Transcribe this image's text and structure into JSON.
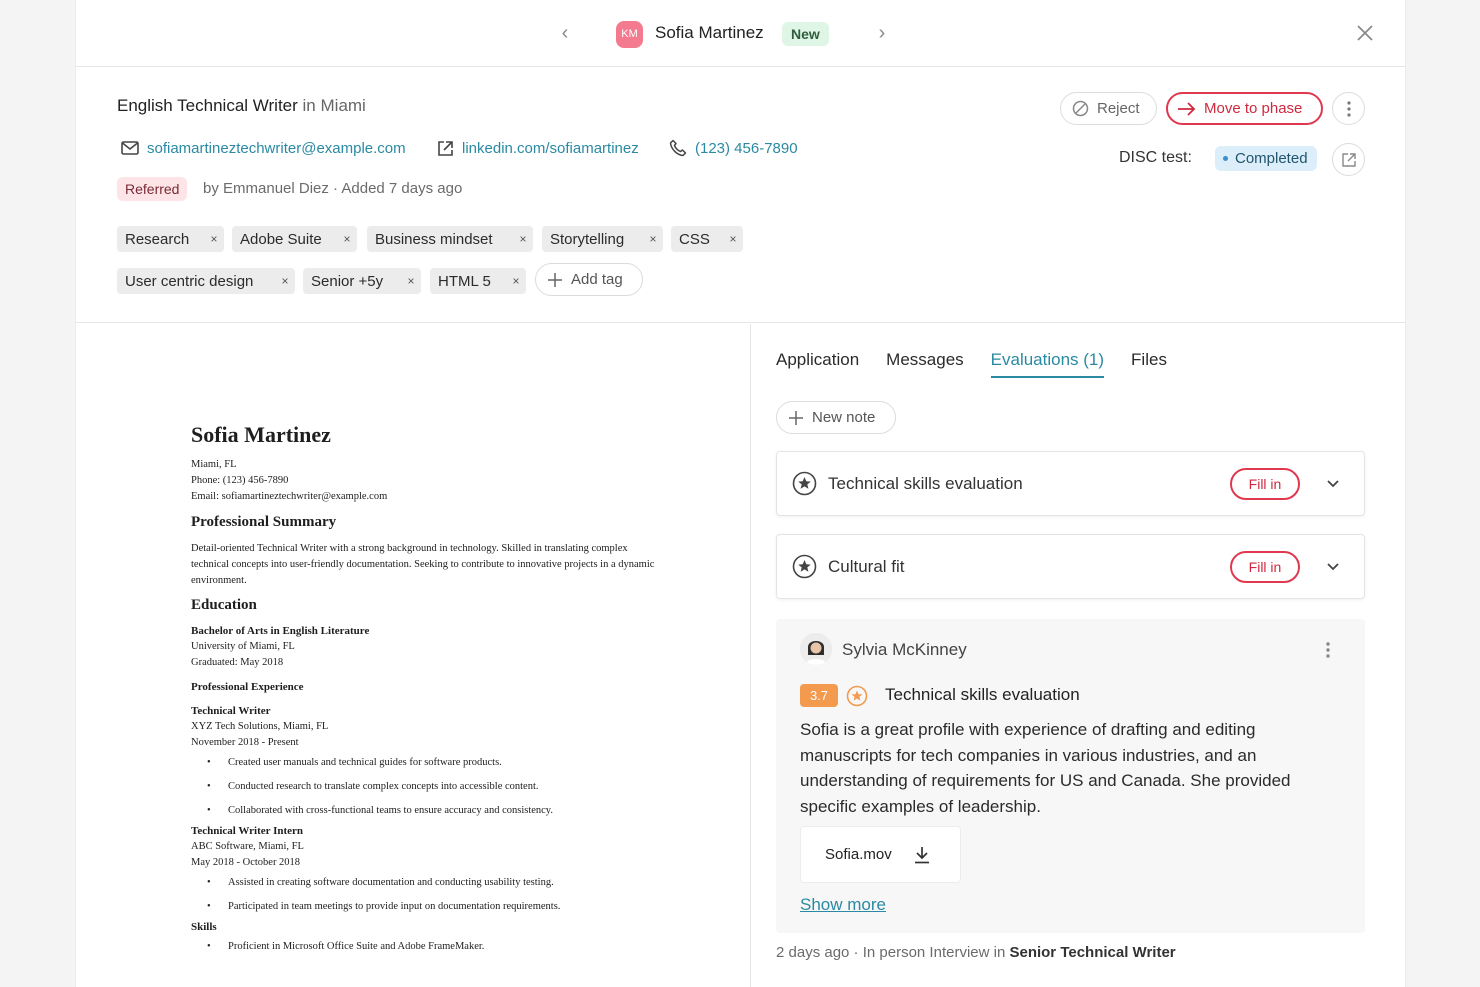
{
  "nav": {
    "avatar_initials": "KM",
    "candidate_name": "Sofia Martinez",
    "status_badge": "New"
  },
  "header": {
    "job_title": "English Technical Writer",
    "job_in": "in",
    "job_location": "Miami",
    "email": "sofiamartineztechwriter@example.com",
    "linkedin": "linkedin.com/sofiamartinez",
    "phone": "(123) 456-7890",
    "referral_badge": "Referred",
    "referral_meta": "by Emmanuel Diez · Added 7 days ago",
    "tags": [
      "Research",
      "Adobe Suite",
      "Business mindset",
      "Storytelling",
      "CSS",
      "User centric design",
      "Senior +5y",
      "HTML 5"
    ],
    "tag_remove_glyph": "×",
    "add_tag_label": "Add tag",
    "reject_label": "Reject",
    "move_label": "Move to phase",
    "disc_label": "DISC test:",
    "disc_status": "Completed",
    "colors": {
      "accent": "#2a8aa3",
      "primary": "#e0384f"
    }
  },
  "resume": {
    "name": "Sofia Martinez",
    "contact_lines": [
      "Miami, FL",
      "Phone: (123) 456-7890",
      "Email: sofiamartineztechwriter@example.com"
    ],
    "summary_heading": "Professional Summary",
    "summary": "Detail-oriented Technical Writer with a strong background in technology. Skilled in translating complex technical concepts into user-friendly documentation. Seeking to contribute to innovative projects in a dynamic environment.",
    "education_heading": "Education",
    "degree": "Bachelor of Arts in English Literature",
    "university": "University of Miami, FL",
    "graduated": "Graduated: May 2018",
    "experience_heading": "Professional Experience",
    "job1_title": "Technical Writer",
    "job1_company": "XYZ Tech Solutions, Miami, FL",
    "job1_dates": "November 2018 - Present",
    "job1_bullets": [
      "Created user manuals and technical guides for software products.",
      "Conducted research to translate complex concepts into accessible content.",
      "Collaborated with cross-functional teams to ensure accuracy and consistency."
    ],
    "job2_title": "Technical Writer Intern",
    "job2_company": "ABC Software, Miami, FL",
    "job2_dates": "May 2018 - October 2018",
    "job2_bullets": [
      "Assisted in creating software documentation and conducting usability testing.",
      "Participated in team meetings to provide input on documentation requirements."
    ],
    "skills_heading": "Skills",
    "skills_bullets": [
      "Proficient in Microsoft Office Suite and Adobe FrameMaker."
    ]
  },
  "tabs": [
    {
      "label": "Application"
    },
    {
      "label": "Messages"
    },
    {
      "label": "Evaluations (1)"
    },
    {
      "label": "Files"
    }
  ],
  "evaluations": {
    "new_note_label": "New note",
    "cards": [
      {
        "title": "Technical skills evaluation",
        "action": "Fill in"
      },
      {
        "title": "Cultural fit",
        "action": "Fill in"
      }
    ],
    "review": {
      "reviewer": "Sylvia McKinney",
      "score": "3.7",
      "title": "Technical skills evaluation",
      "body": "Sofia is a great profile with experience of drafting and editing manuscripts for tech companies in various industries, and an understanding of requirements for US and Canada. She provided specific examples of leadership.",
      "attachment": "Sofia.mov",
      "show_more": "Show more"
    },
    "footer_meta": "2 days ago · In person Interview in",
    "footer_position": "Senior Technical Writer"
  }
}
